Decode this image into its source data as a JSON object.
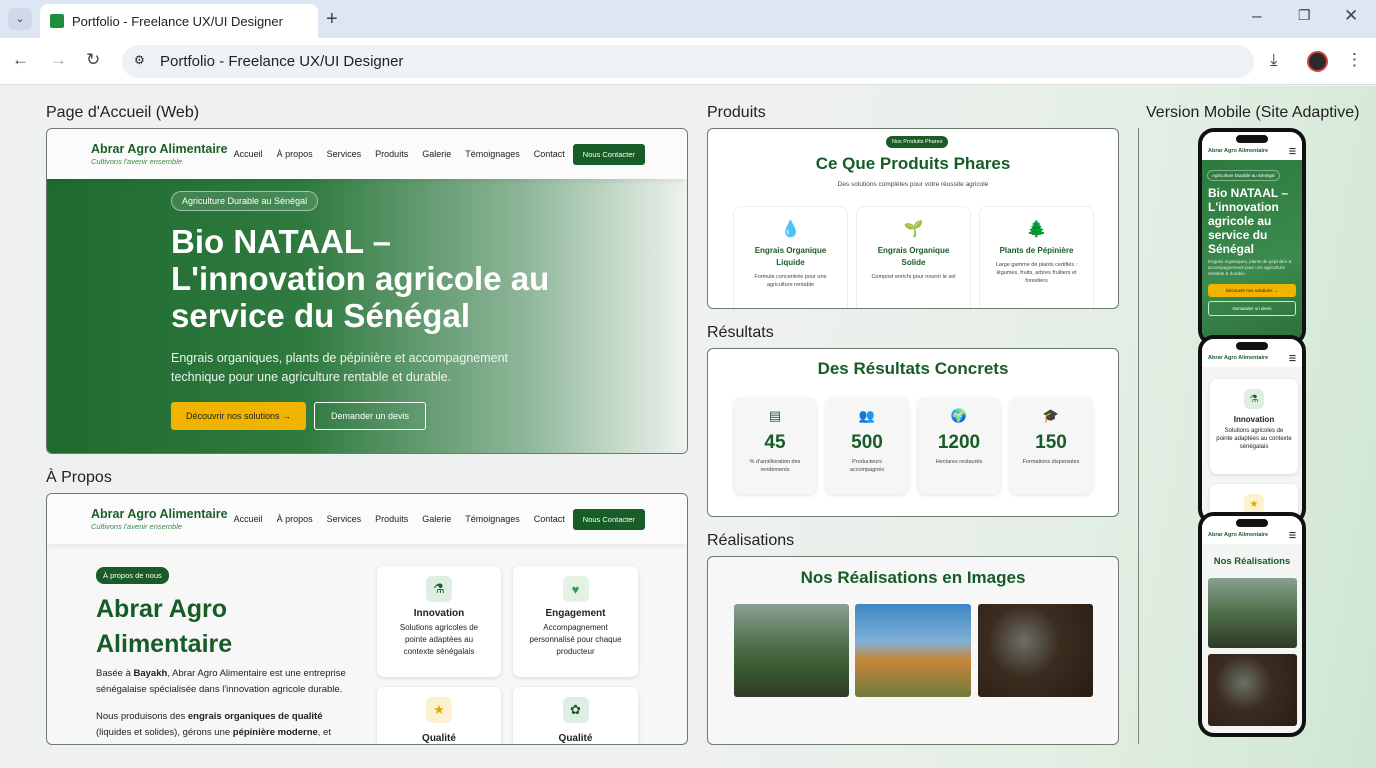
{
  "browser": {
    "tab_title": "Portfolio - Freelance UX/UI Designer",
    "url_text": "Portfolio - Freelance UX/UI Designer"
  },
  "sections": {
    "home": "Page d'Accueil (Web)",
    "about": "À Propos",
    "products": "Produits",
    "results": "Résultats",
    "realisations": "Réalisations",
    "mobile": "Version Mobile (Site Adaptive)"
  },
  "site": {
    "brand": "Abrar Agro Alimentaire",
    "tagline": "Cultivons l'avenir ensemble",
    "nav": [
      "Accueil",
      "À propos",
      "Services",
      "Produits",
      "Galerie",
      "Témoignages",
      "Contact"
    ],
    "cta": "Nous Contacter"
  },
  "hero": {
    "badge": "Agriculture Durable au Sénégal",
    "title": "Bio NATAAL – L'innovation agricole au service du Sénégal",
    "subtitle": "Engrais organiques, plants de pépinière et accompagnement technique pour une agriculture rentable et durable.",
    "primary": "Découvrir nos solutions →",
    "secondary": "Demander un devis"
  },
  "about": {
    "badge": "À propos de nous",
    "title": "Abrar Agro Alimentaire",
    "p1_a": "Basée à ",
    "p1_b": "Bayakh",
    "p1_c": ", Abrar Agro Alimentaire est une entreprise sénégalaise spécialisée dans l'innovation agricole durable.",
    "p2_a": "Nous produisons des ",
    "p2_b": "engrais organiques de qualité",
    "p2_c": " (liquides et solides), gérons une ",
    "p2_d": "pépinière moderne",
    "p2_e": ", et",
    "cards": [
      {
        "title": "Innovation",
        "text": "Solutions agricoles de pointe adaptées au contexte sénégalais"
      },
      {
        "title": "Engagement",
        "text": "Accompagnement personnalisé pour chaque producteur"
      },
      {
        "title": "Qualité",
        "text": ""
      },
      {
        "title": "Qualité",
        "text": ""
      }
    ]
  },
  "products": {
    "badge": "Nos Produits Phares",
    "title": "Ce Que Produits Phares",
    "subtitle": "Des solutions complètes pour votre réussite agricole",
    "items": [
      {
        "title": "Engrais Organique Liquide",
        "text": "Formule concentrée pour une agriculture rentable"
      },
      {
        "title": "Engrais Organique Solide",
        "text": "Compost enrichi pour nourrir le sol"
      },
      {
        "title": "Plants de Pépinière",
        "text": "Large gamme de plants certifiés : légumes, fruits, arbres fruitiers et forestiers"
      }
    ]
  },
  "results": {
    "title": "Des Résultats Concrets",
    "stats": [
      {
        "value": "45",
        "label": "% d'amélioration des rendements"
      },
      {
        "value": "500",
        "label": "Producteurs accompagnés"
      },
      {
        "value": "1200",
        "label": "Hectares restaurés"
      },
      {
        "value": "150",
        "label": "Formations dispensées"
      }
    ]
  },
  "gallery": {
    "title": "Nos Réalisations en Images"
  },
  "mobile": {
    "brand": "Abrar Agro Alimentaire",
    "hero_title": "Bio NATAAL – L'innovation agricole au service du Sénégal",
    "hero_text": "Engrais organiques, plants de pépinière & accompagnement pour une agriculture rentable & durable.",
    "badge": "Agriculture Durable au Sénégal",
    "primary": "Découvrir nos solutions →",
    "secondary": "Demander un devis",
    "card_title": "Innovation",
    "card_text": "Solutions agricoles de pointe adaptées au contexte sénégalais",
    "gallery_title": "Nos Réalisations"
  },
  "colors": {
    "primary": "#185c27",
    "accent": "#f0b400"
  }
}
